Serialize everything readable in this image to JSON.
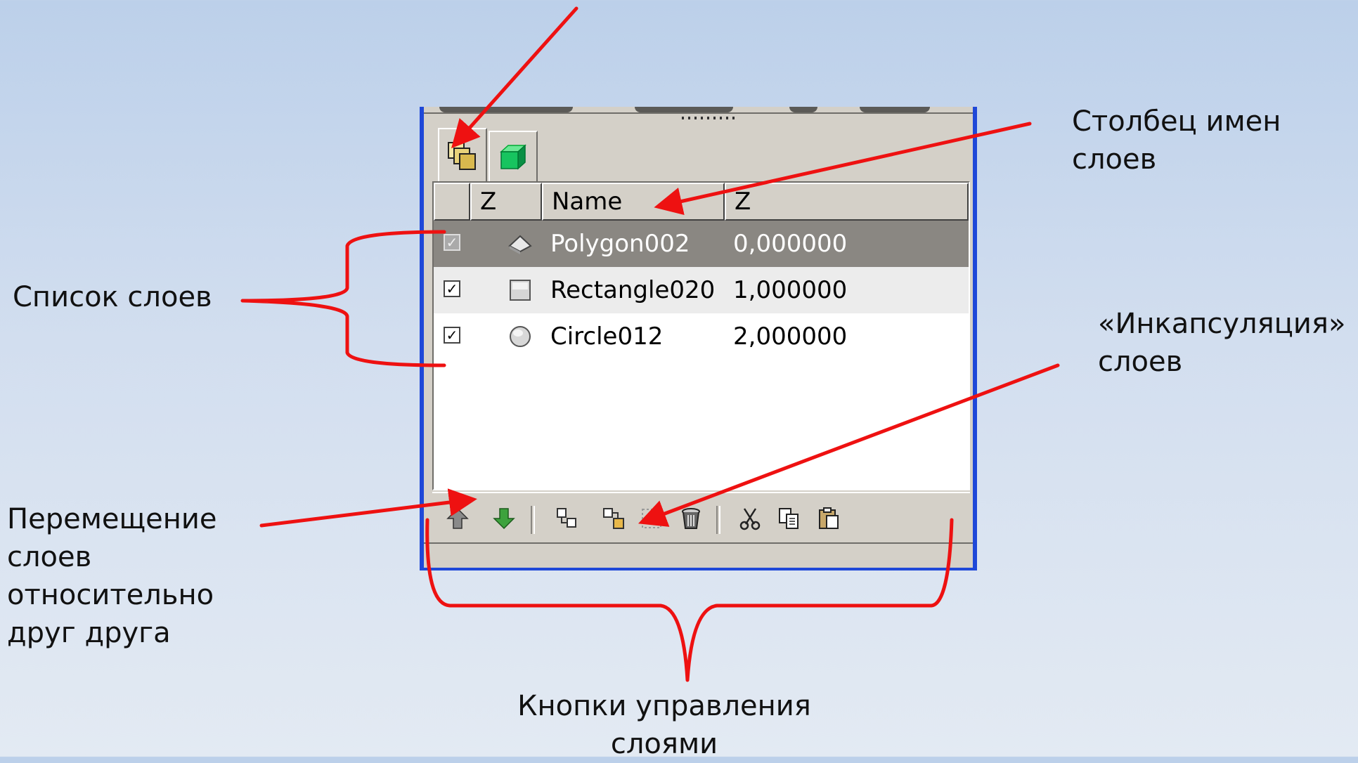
{
  "annotations": {
    "layers_list": "Список слоев",
    "names_column": "Столбец имен\nслоев",
    "encapsulation": "«Инкапсуляция»\nслоев",
    "move_layers": "Перемещение\nслоев\nотносительно\nдруг друга",
    "control_buttons": "Кнопки управления\nслоями"
  },
  "colors": {
    "annotation_arrow": "#ee1111",
    "panel_border": "#1f48d8",
    "selected_row": "#8a8782"
  },
  "tabs": [
    {
      "icon": "layers-icon",
      "active": true
    },
    {
      "icon": "3d-cube-icon",
      "active": false
    }
  ],
  "columns": {
    "z": "Z",
    "name": "Name",
    "zdepth": "Z"
  },
  "layers": [
    {
      "checked": true,
      "icon": "polygon-icon",
      "name": "Polygon002",
      "z": "0,000000",
      "selected": true
    },
    {
      "checked": true,
      "icon": "rectangle-icon",
      "name": "Rectangle020",
      "z": "1,000000",
      "selected": false
    },
    {
      "checked": true,
      "icon": "circle-icon",
      "name": "Circle012",
      "z": "2,000000",
      "selected": false
    }
  ],
  "toolbar": [
    "raise-layer-icon",
    "lower-layer-icon",
    "encapsulate-icon",
    "encapsulate-switch-icon",
    "encapsulate-filter-icon",
    "delete-layer-icon",
    "cut-icon",
    "copy-icon",
    "paste-icon"
  ]
}
